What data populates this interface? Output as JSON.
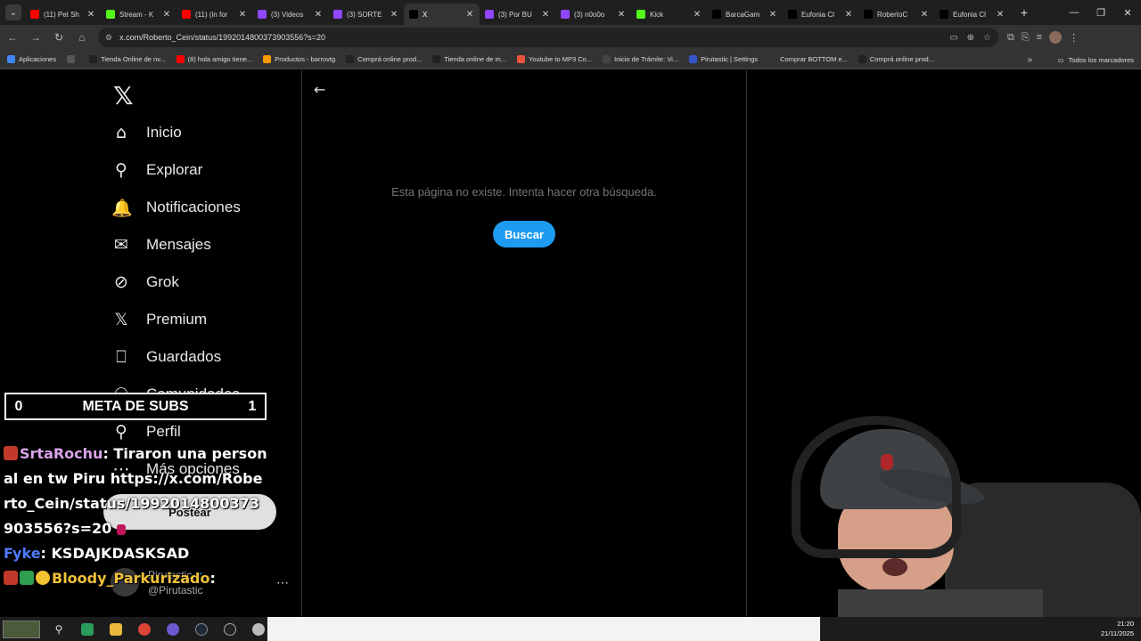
{
  "browser": {
    "tabs": [
      {
        "title": "(11) Pet Sh",
        "favicon_color": "#ff0000"
      },
      {
        "title": "Stream - K",
        "favicon_color": "#53fc18"
      },
      {
        "title": "(11) (in for",
        "favicon_color": "#ff0000"
      },
      {
        "title": "(3) Videos",
        "favicon_color": "#9146ff"
      },
      {
        "title": "(3) SORTE",
        "favicon_color": "#9146ff"
      },
      {
        "title": "X",
        "favicon_color": "#000000",
        "active": true
      },
      {
        "title": "(3) Por BU",
        "favicon_color": "#9146ff"
      },
      {
        "title": "(3) n0o0o",
        "favicon_color": "#9146ff"
      },
      {
        "title": "Kick",
        "favicon_color": "#53fc18"
      },
      {
        "title": "BarcaGam",
        "favicon_color": "#000000"
      },
      {
        "title": "Eufonia Cl",
        "favicon_color": "#000000"
      },
      {
        "title": "RobertoC",
        "favicon_color": "#000000"
      },
      {
        "title": "Eufonia Cl",
        "favicon_color": "#000000"
      }
    ],
    "new_tab_label": "+",
    "url": "x.com/Roberto_Cein/status/1992014800373903556?s=20",
    "bookmarks": [
      {
        "label": "Aplicaciones",
        "color": "#4285f4"
      },
      {
        "label": "",
        "color": "#555555"
      },
      {
        "label": "Tienda Online de nv...",
        "color": "#222222"
      },
      {
        "label": "(8) hola amigo tiene...",
        "color": "#ff0000"
      },
      {
        "label": "Productos - barrovtg",
        "color": "#ff9900"
      },
      {
        "label": "Comprá online prod...",
        "color": "#222222"
      },
      {
        "label": "Tienda online de m...",
        "color": "#222222"
      },
      {
        "label": "Youtube to MP3 Co...",
        "color": "#e5533d"
      },
      {
        "label": "Inicio de Trámite: Vi...",
        "color": "#444444"
      },
      {
        "label": "Pirutastic | Settings",
        "color": "#3355cc"
      },
      {
        "label": "Comprar BOTTOM e...",
        "color": "#333333"
      },
      {
        "label": "Comprá online prod...",
        "color": "#222222"
      }
    ],
    "bookmarks_more": "»",
    "all_bookmarks": "Todos los marcadores"
  },
  "sidebar": {
    "logo": "𝕏",
    "items": [
      {
        "label": "Inicio",
        "icon": "home-icon",
        "glyph": "⌂"
      },
      {
        "label": "Explorar",
        "icon": "search-icon",
        "glyph": "⚲"
      },
      {
        "label": "Notificaciones",
        "icon": "bell-icon",
        "glyph": "🔔"
      },
      {
        "label": "Mensajes",
        "icon": "mail-icon",
        "glyph": "✉"
      },
      {
        "label": "Grok",
        "icon": "grok-icon",
        "glyph": "⊘"
      },
      {
        "label": "Premium",
        "icon": "x-premium-icon",
        "glyph": "𝕏"
      },
      {
        "label": "Guardados",
        "icon": "bookmark-icon",
        "glyph": "⎕"
      },
      {
        "label": "Comunidades",
        "icon": "communities-icon",
        "glyph": "⚇"
      },
      {
        "label": "Perfil",
        "icon": "profile-icon",
        "glyph": "⚲"
      },
      {
        "label": "Más opciones",
        "icon": "more-icon",
        "glyph": "⋯"
      }
    ],
    "post_label": "Postear",
    "account": {
      "name": "Pirutastic",
      "handle": "@Pirutastic"
    }
  },
  "main": {
    "back_glyph": "←",
    "not_found_text": "Esta página no existe. Intenta hacer otra búsqueda.",
    "search_button": "Buscar"
  },
  "overlay": {
    "meta": {
      "left": "0",
      "title": "META DE SUBS",
      "right": "1"
    },
    "chat": [
      {
        "user": "SrtaRochu",
        "user_color": "#d7a4e8",
        "text": "Tiraron una personal en tw Piru https://x.com/Roberto_Cein/status/1992014800373903556?s=20"
      },
      {
        "user": "Fyke",
        "user_color": "#4f7bff",
        "text": "KSDAJKDASKSAD"
      },
      {
        "user": "Bloody_Parkurizado",
        "user_color": "#f0c13a",
        "text": ""
      }
    ]
  },
  "taskbar": {
    "time": "21:20",
    "date": "21/11/2025"
  }
}
